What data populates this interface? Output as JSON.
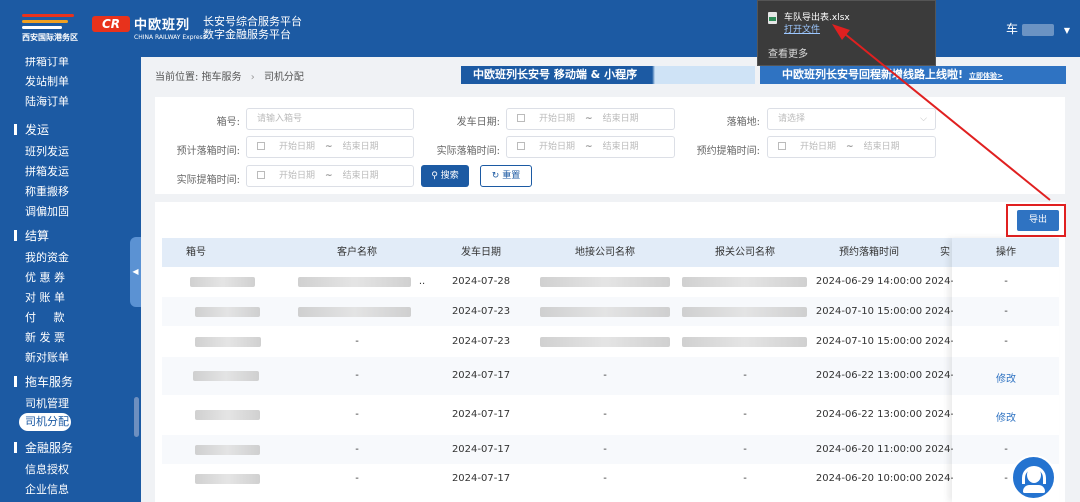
{
  "header": {
    "logo1_text": "西安国际港务区",
    "logo2_mark": "CR",
    "logo2_name": "中欧班列",
    "logo2_sub": "CHINA RAILWAY Express",
    "platform_line1": "长安号综合服务平台",
    "platform_line2": "数字金融服务平台",
    "user_suffix": "车"
  },
  "sidebar": {
    "items_top": [
      "拼箱订单",
      "发站制单",
      "陆海订单"
    ],
    "groups": [
      {
        "label": "发运",
        "items": [
          "班列发运",
          "拼箱发运",
          "称重搬移",
          "调偏加固"
        ]
      },
      {
        "label": "结算",
        "items": [
          "我的资金",
          "优 惠 券",
          "对 账 单",
          "付     款",
          "新 发 票",
          "新对账单"
        ]
      },
      {
        "label": "拖车服务",
        "items": [
          "司机管理",
          "司机分配"
        ]
      },
      {
        "label": "金融服务",
        "items": [
          "信息授权",
          "企业信息"
        ]
      }
    ],
    "active_item": "司机分配"
  },
  "breadcrumb": {
    "prefix": "当前位置:",
    "level1": "拖车服务",
    "level2": "司机分配"
  },
  "banners": {
    "banner1": "中欧班列长安号 移动端 & 小程序",
    "banner2": "中欧班列长安号回程新增线路上线啦!",
    "banner2_link": "立即体验>"
  },
  "filters": {
    "box_no_label": "箱号:",
    "box_no_placeholder": "请输入箱号",
    "depart_date_label": "发车日期:",
    "est_drop_label": "预计落箱时间:",
    "actual_drop_label": "实际落箱时间:",
    "appt_pickup_label": "预约提箱时间:",
    "actual_pickup_label": "实际提箱时间:",
    "drop_place_label": "落箱地:",
    "drop_place_placeholder": "请选择",
    "start_placeholder": "开始日期",
    "end_placeholder": "结束日期",
    "range_sep": "~",
    "search_label": "搜索",
    "reset_label": "重置"
  },
  "toolbar": {
    "export_label": "导出"
  },
  "table": {
    "headers": [
      "箱号",
      "客户名称",
      "发车日期",
      "地接公司名称",
      "报关公司名称",
      "预约落箱时间",
      "实",
      "操作"
    ],
    "rows": [
      {
        "depart": "2024-07-28",
        "customer": "..",
        "local": "",
        "customs": "",
        "appt": "2024-06-29 14:00:00",
        "actual": "2024-",
        "op": "-"
      },
      {
        "depart": "2024-07-23",
        "customer": "",
        "local": "",
        "customs": "",
        "appt": "2024-07-10 15:00:00",
        "actual": "2024-",
        "op": "-"
      },
      {
        "depart": "2024-07-23",
        "customer": "-",
        "local": "",
        "customs": "",
        "appt": "2024-07-10 15:00:00",
        "actual": "2024-",
        "op": "-"
      },
      {
        "depart": "2024-07-17",
        "customer": "-",
        "local": "-",
        "customs": "-",
        "appt": "2024-06-22 13:00:00",
        "actual": "2024-",
        "op": "修改"
      },
      {
        "depart": "2024-07-17",
        "customer": "-",
        "local": "-",
        "customs": "-",
        "appt": "2024-06-22 13:00:00",
        "actual": "2024-",
        "op": "修改"
      },
      {
        "depart": "2024-07-17",
        "customer": "-",
        "local": "-",
        "customs": "-",
        "appt": "2024-06-20 11:00:00",
        "actual": "2024-",
        "op": "-"
      },
      {
        "depart": "2024-07-17",
        "customer": "-",
        "local": "-",
        "customs": "-",
        "appt": "2024-06-20 10:00:00",
        "actual": "2024-",
        "op": "-"
      }
    ]
  },
  "download_popup": {
    "file_name": "车队导出表.xlsx",
    "open_file": "打开文件",
    "see_more": "查看更多"
  },
  "colors": {
    "brand_blue": "#1c5aa3",
    "accent_blue": "#2f73c2",
    "highlight_red": "#e02020",
    "table_header_bg": "#e2ecf8"
  }
}
